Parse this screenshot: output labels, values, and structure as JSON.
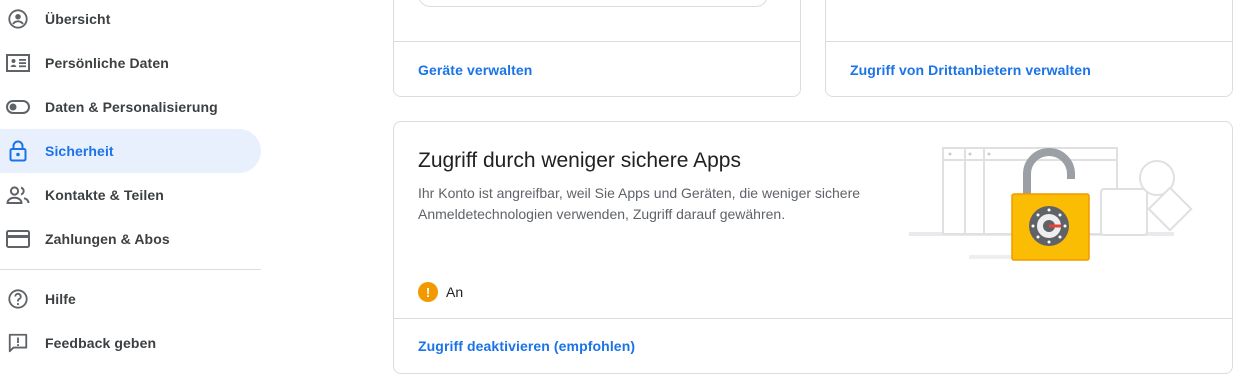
{
  "sidebar": {
    "items": [
      {
        "label": "Übersicht",
        "icon": "account-circle-icon"
      },
      {
        "label": "Persönliche Daten",
        "icon": "id-card-icon"
      },
      {
        "label": "Daten & Personalisierung",
        "icon": "toggle-icon"
      },
      {
        "label": "Sicherheit",
        "icon": "lock-icon",
        "active": true
      },
      {
        "label": "Kontakte & Teilen",
        "icon": "people-icon"
      },
      {
        "label": "Zahlungen & Abos",
        "icon": "credit-card-icon"
      }
    ],
    "footer_items": [
      {
        "label": "Hilfe",
        "icon": "help-icon"
      },
      {
        "label": "Feedback geben",
        "icon": "feedback-icon"
      }
    ]
  },
  "cards": {
    "devices": {
      "link": "Geräte verwalten"
    },
    "third_party": {
      "link": "Zugriff von Drittanbietern verwalten"
    },
    "less_secure": {
      "title": "Zugriff durch weniger sichere Apps",
      "description": "Ihr Konto ist angreifbar, weil Sie Apps und Geräten, die weniger sichere Anmeldetechnologien verwenden, Zugriff darauf gewähren.",
      "status_icon": "!",
      "status": "An",
      "link": "Zugriff deaktivieren (empfohlen)",
      "illustration": "open-padlock-illustration"
    }
  },
  "colors": {
    "accent": "#1a73e8",
    "active_bg": "#e8f0fe",
    "warning": "#f29900",
    "lock": "#fbbc04"
  }
}
